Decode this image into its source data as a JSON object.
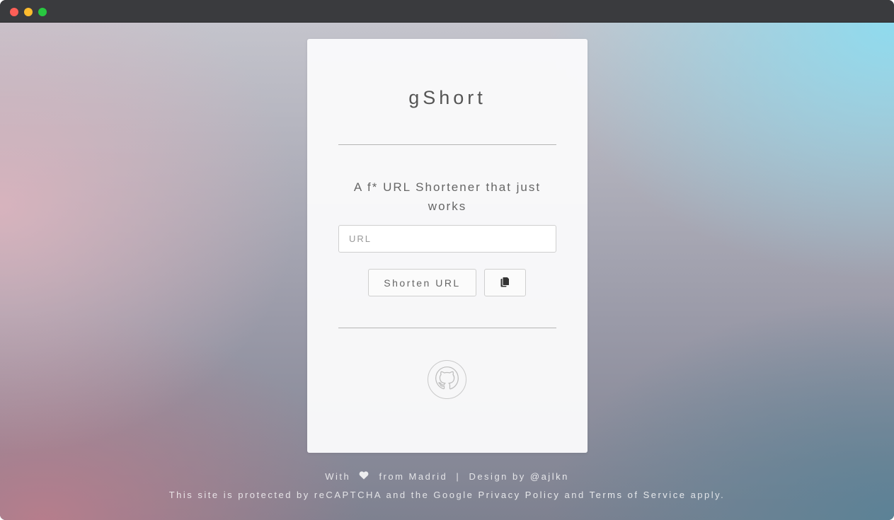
{
  "app": {
    "title": "gShort",
    "tagline": "A f* URL Shortener that just works"
  },
  "form": {
    "url_placeholder": "URL",
    "url_value": "",
    "shorten_label": "Shorten URL",
    "copy_icon": "copy-icon"
  },
  "links": {
    "github_icon": "github-icon"
  },
  "footer": {
    "with": "With",
    "heart_icon": "heart-icon",
    "from": "from Madrid",
    "separator": "|",
    "design_by": "Design by",
    "author": "@ajlkn",
    "recaptcha_prefix": "This site is protected by reCAPTCHA and the Google",
    "privacy_policy": "Privacy Policy",
    "and": "and",
    "terms": "Terms of Service",
    "apply": "apply."
  }
}
